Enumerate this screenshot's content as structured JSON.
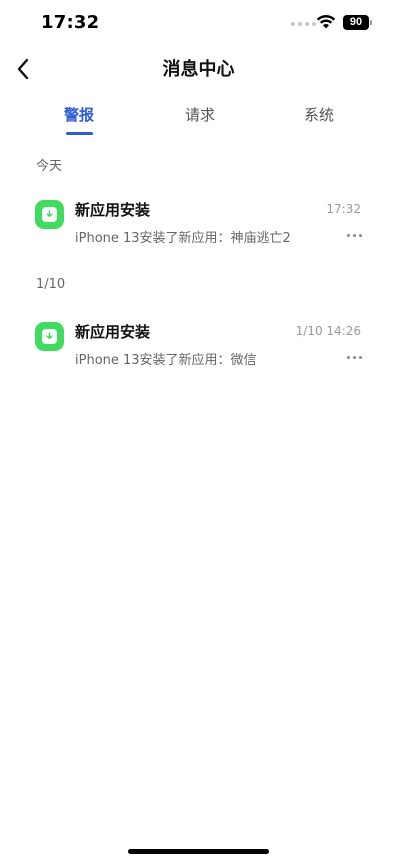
{
  "status_bar": {
    "time": "17:32",
    "battery": "90"
  },
  "header": {
    "title": "消息中心",
    "back_icon": "chevron-left-icon"
  },
  "tabs": [
    {
      "label": "警报",
      "active": true
    },
    {
      "label": "请求",
      "active": false
    },
    {
      "label": "系统",
      "active": false
    }
  ],
  "sections": [
    {
      "header": "今天",
      "items": [
        {
          "title": "新应用安装",
          "time": "17:32",
          "body": "iPhone 13安装了新应用：神庙逃亡2",
          "icon": "app-install-icon"
        }
      ]
    },
    {
      "header": "1/10",
      "items": [
        {
          "title": "新应用安装",
          "time": "1/10 14:26",
          "body": "iPhone 13安装了新应用：微信",
          "icon": "app-install-icon"
        }
      ]
    }
  ],
  "colors": {
    "accent": "#2f5bd4",
    "app_icon_bg": "#3fdc5f"
  }
}
